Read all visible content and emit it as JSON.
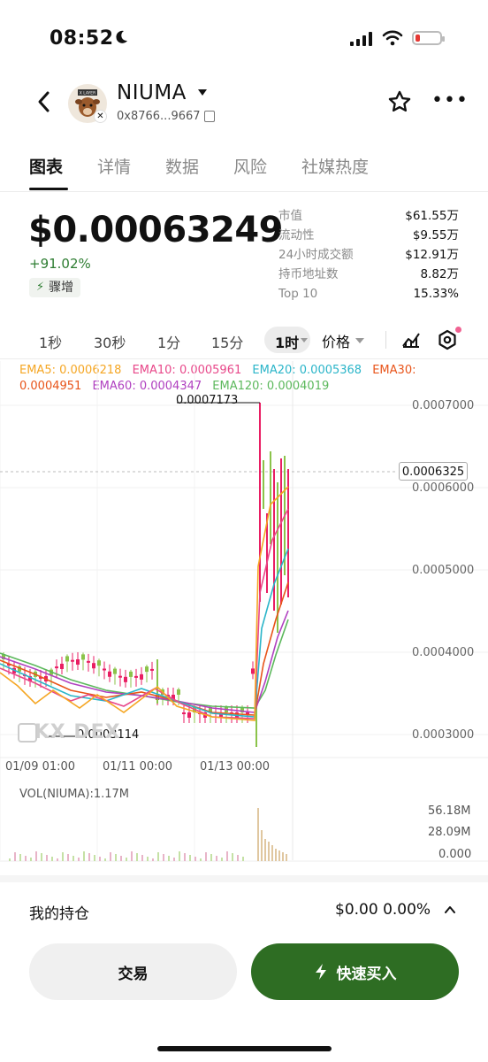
{
  "status_bar": {
    "time": "08:52"
  },
  "header": {
    "token_name": "NIUMA",
    "token_address": "0x8766...9667",
    "avatar_text": "X LAYER"
  },
  "tabs": [
    "图表",
    "详情",
    "数据",
    "风险",
    "社媒热度"
  ],
  "active_tab": 0,
  "price": {
    "value": "$0.00063249",
    "change": "+91.02%",
    "badge": "骤增"
  },
  "stats": [
    {
      "label": "市值",
      "value": "$61.55万"
    },
    {
      "label": "流动性",
      "value": "$9.55万"
    },
    {
      "label": "24小时成交额",
      "value": "$12.91万"
    },
    {
      "label": "持币地址数",
      "value": "8.82万"
    },
    {
      "label": "Top 10",
      "value": "15.33%"
    }
  ],
  "intervals": [
    "1秒",
    "30秒",
    "1分",
    "15分"
  ],
  "selected_interval": "1时",
  "price_mode": "价格",
  "ema": {
    "ema5": "EMA5: 0.0006218",
    "ema10": "EMA10: 0.0005961",
    "ema20": "EMA20: 0.0005368",
    "ema30_label": "EMA30:",
    "ema30_value": "0.0004951",
    "ema60": "EMA60: 0.0004347",
    "ema120": "EMA120: 0.0004019",
    "colors": {
      "ema5": "#f5a623",
      "ema10": "#e8488a",
      "ema20": "#2bb5c9",
      "ema30": "#e8541a",
      "ema60": "#b040c0",
      "ema120": "#5cb85c"
    }
  },
  "chart": {
    "y_labels": [
      "0.0007000",
      "0.0006000",
      "0.0005000",
      "0.0004000",
      "0.0003000"
    ],
    "x_labels": [
      "01/09 01:00",
      "01/11 00:00",
      "01/13 00:00"
    ],
    "current_price": "0.0006325",
    "high": "0.0007173",
    "low": "0.0003114",
    "watermark": "OKX DEX",
    "up_color": "#8bc34a",
    "down_color": "#e91e63"
  },
  "volume": {
    "label": "VOL(NIUMA):1.17M",
    "y_labels": [
      "56.18M",
      "28.09M",
      "0.000"
    ]
  },
  "holdings": {
    "label": "我的持仓",
    "value": "$0.00 0.00%"
  },
  "buttons": {
    "trade": "交易",
    "quick_buy": "快速买入"
  }
}
